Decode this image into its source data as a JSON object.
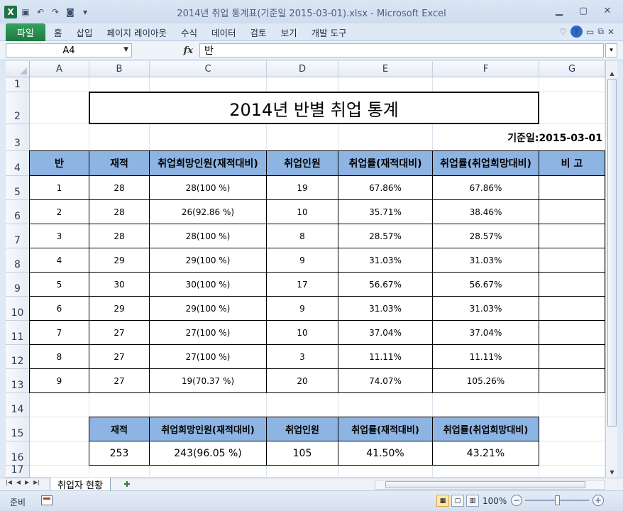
{
  "window": {
    "title": "2014년 취업 통계표(기준일 2015-03-01).xlsx  -  Microsoft Excel"
  },
  "qat": {
    "app_icon": "X",
    "items": [
      "save-icon",
      "undo-icon",
      "redo-icon",
      "camera-icon",
      "customize-icon"
    ]
  },
  "ribbon": {
    "file_tab": "파일",
    "tabs": [
      "홈",
      "삽입",
      "페이지 레이아웃",
      "수식",
      "데이터",
      "검토",
      "보기",
      "개발 도구"
    ]
  },
  "formula_bar": {
    "name_box": "A4",
    "fx": "fx",
    "content": "반"
  },
  "columns": [
    "A",
    "B",
    "C",
    "D",
    "E",
    "F",
    "G"
  ],
  "rows": [
    "1",
    "2",
    "3",
    "4",
    "5",
    "6",
    "7",
    "8",
    "9",
    "10",
    "11",
    "12",
    "13",
    "14",
    "15",
    "16",
    "17"
  ],
  "sheet": {
    "title": "2014년 반별 취업 통계",
    "date_label": "기준일:2015-03-01",
    "headers": [
      "반",
      "재적",
      "취업희망인원(재적대비)",
      "취업인원",
      "취업률(재적대비)",
      "취업률(취업희망대비)",
      "비 고"
    ],
    "rows": [
      [
        "1",
        "28",
        "28(100 %)",
        "19",
        "67.86%",
        "67.86%",
        ""
      ],
      [
        "2",
        "28",
        "26(92.86 %)",
        "10",
        "35.71%",
        "38.46%",
        ""
      ],
      [
        "3",
        "28",
        "28(100 %)",
        "8",
        "28.57%",
        "28.57%",
        ""
      ],
      [
        "4",
        "29",
        "29(100 %)",
        "9",
        "31.03%",
        "31.03%",
        ""
      ],
      [
        "5",
        "30",
        "30(100 %)",
        "17",
        "56.67%",
        "56.67%",
        ""
      ],
      [
        "6",
        "29",
        "29(100 %)",
        "9",
        "31.03%",
        "31.03%",
        ""
      ],
      [
        "7",
        "27",
        "27(100 %)",
        "10",
        "37.04%",
        "37.04%",
        ""
      ],
      [
        "8",
        "27",
        "27(100 %)",
        "3",
        "11.11%",
        "11.11%",
        ""
      ],
      [
        "9",
        "27",
        "19(70.37 %)",
        "20",
        "74.07%",
        "105.26%",
        ""
      ]
    ],
    "summary_headers": [
      "재적",
      "취업희망인원(재적대비)",
      "취업인원",
      "취업률(재적대비)",
      "취업률(취업희망대비)"
    ],
    "summary_values": [
      "253",
      "243(96.05 %)",
      "105",
      "41.50%",
      "43.21%"
    ]
  },
  "sheet_tabs": [
    "취업자 현황"
  ],
  "status": {
    "mode": "준비",
    "zoom": "100%"
  },
  "colors": {
    "header_fill": "#8db4e2",
    "file_tab": "#1e7a3f"
  }
}
